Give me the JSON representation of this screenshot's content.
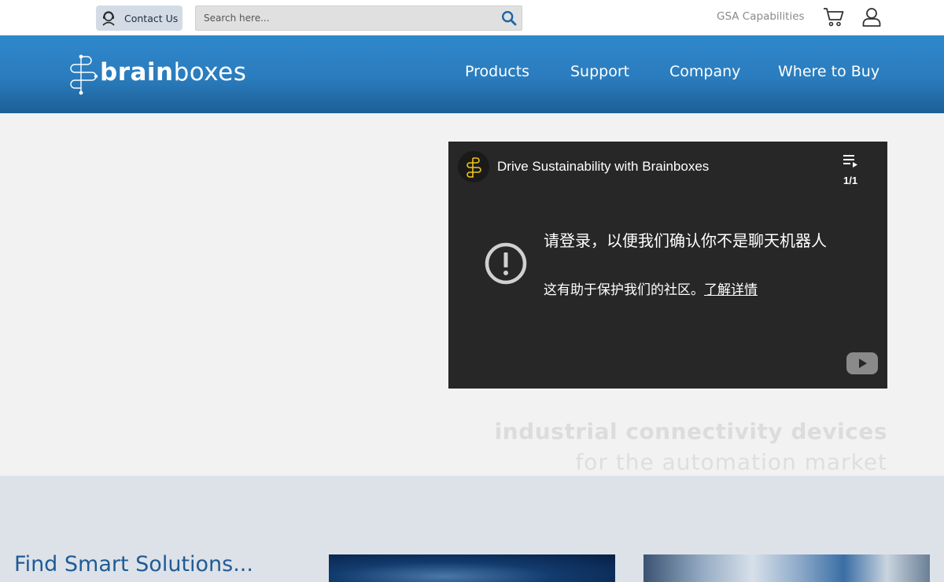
{
  "topbar": {
    "contact_label": "Contact Us",
    "search_placeholder": "Search here...",
    "gsa_label": "GSA Capabilities",
    "icons": [
      "contact-icon",
      "search-icon",
      "cart-icon",
      "user-icon"
    ]
  },
  "header": {
    "logo": {
      "regular": "brain",
      "bold": "",
      "rest": "boxes"
    },
    "nav": [
      "Products",
      "Support",
      "Company",
      "Where to Buy"
    ]
  },
  "video": {
    "title": "Drive Sustainability with Brainboxes",
    "playlist_count": "1/1",
    "message_title": "请登录，以便我们确认你不是聊天机器人",
    "message_body": "这有助于保护我们的社区。",
    "message_link": "了解详情"
  },
  "hero": {
    "tagline_line1": "industrial connectivity devices",
    "tagline_line2": "for the automation market"
  },
  "lower": {
    "heading": "Find Smart Solutions..."
  },
  "colors": {
    "header_blue": "#2f88cc",
    "heading_blue": "#1f5b95",
    "video_bg": "#272727",
    "page_bg": "#f2f2f2",
    "lower_bg": "#dde2e9"
  }
}
